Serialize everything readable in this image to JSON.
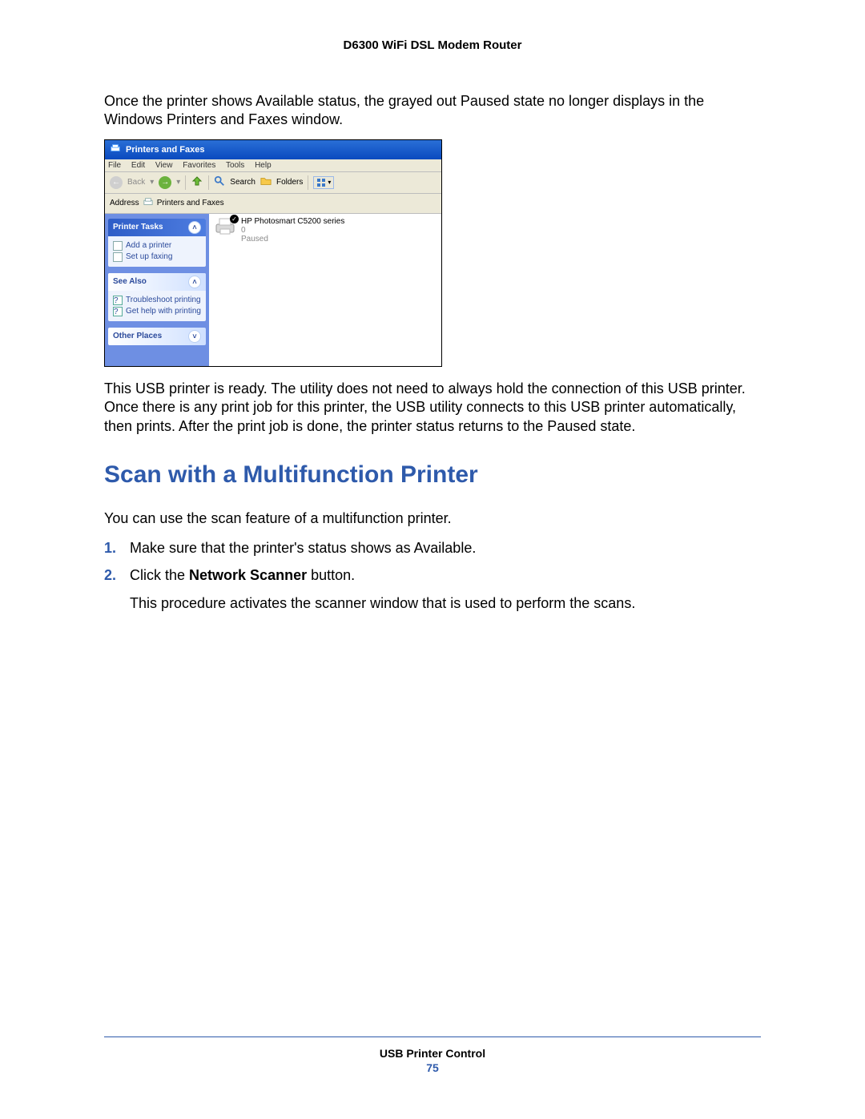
{
  "doc": {
    "title_header": "D6300 WiFi DSL Modem Router",
    "para1": "Once the printer shows Available status, the grayed out Paused state no longer displays in the Windows Printers and Faxes window.",
    "para2": "This USB printer is ready. The utility does not need to always hold the connection of this USB printer. Once there is any print job for this printer, the USB utility connects to this USB printer automatically, then prints. After the print job is done, the printer status returns to the Paused state.",
    "heading": "Scan with a Multifunction Printer",
    "intro2": "You can use the scan feature of a multifunction printer.",
    "step1": "Make sure that the printer's status shows as Available.",
    "step2_pre": "Click the ",
    "step2_bold": "Network Scanner",
    "step2_post": " button.",
    "step2_result": "This procedure activates the scanner window that is used to perform the scans.",
    "footer_section": "USB Printer Control",
    "page_number": "75"
  },
  "win": {
    "title": "Printers and Faxes",
    "menu": {
      "file": "File",
      "edit": "Edit",
      "view": "View",
      "favorites": "Favorites",
      "tools": "Tools",
      "help": "Help"
    },
    "toolbar": {
      "back": "Back",
      "search": "Search",
      "folders": "Folders"
    },
    "address_label": "Address",
    "address_value": "Printers and Faxes",
    "sidebar": {
      "printer_tasks_title": "Printer Tasks",
      "add_printer": "Add a printer",
      "set_up_faxing": "Set up faxing",
      "see_also_title": "See Also",
      "troubleshoot": "Troubleshoot printing",
      "get_help": "Get help with printing",
      "other_places_title": "Other Places"
    },
    "printer": {
      "name": "HP Photosmart C5200 series",
      "doc_count": "0",
      "status": "Paused"
    }
  }
}
